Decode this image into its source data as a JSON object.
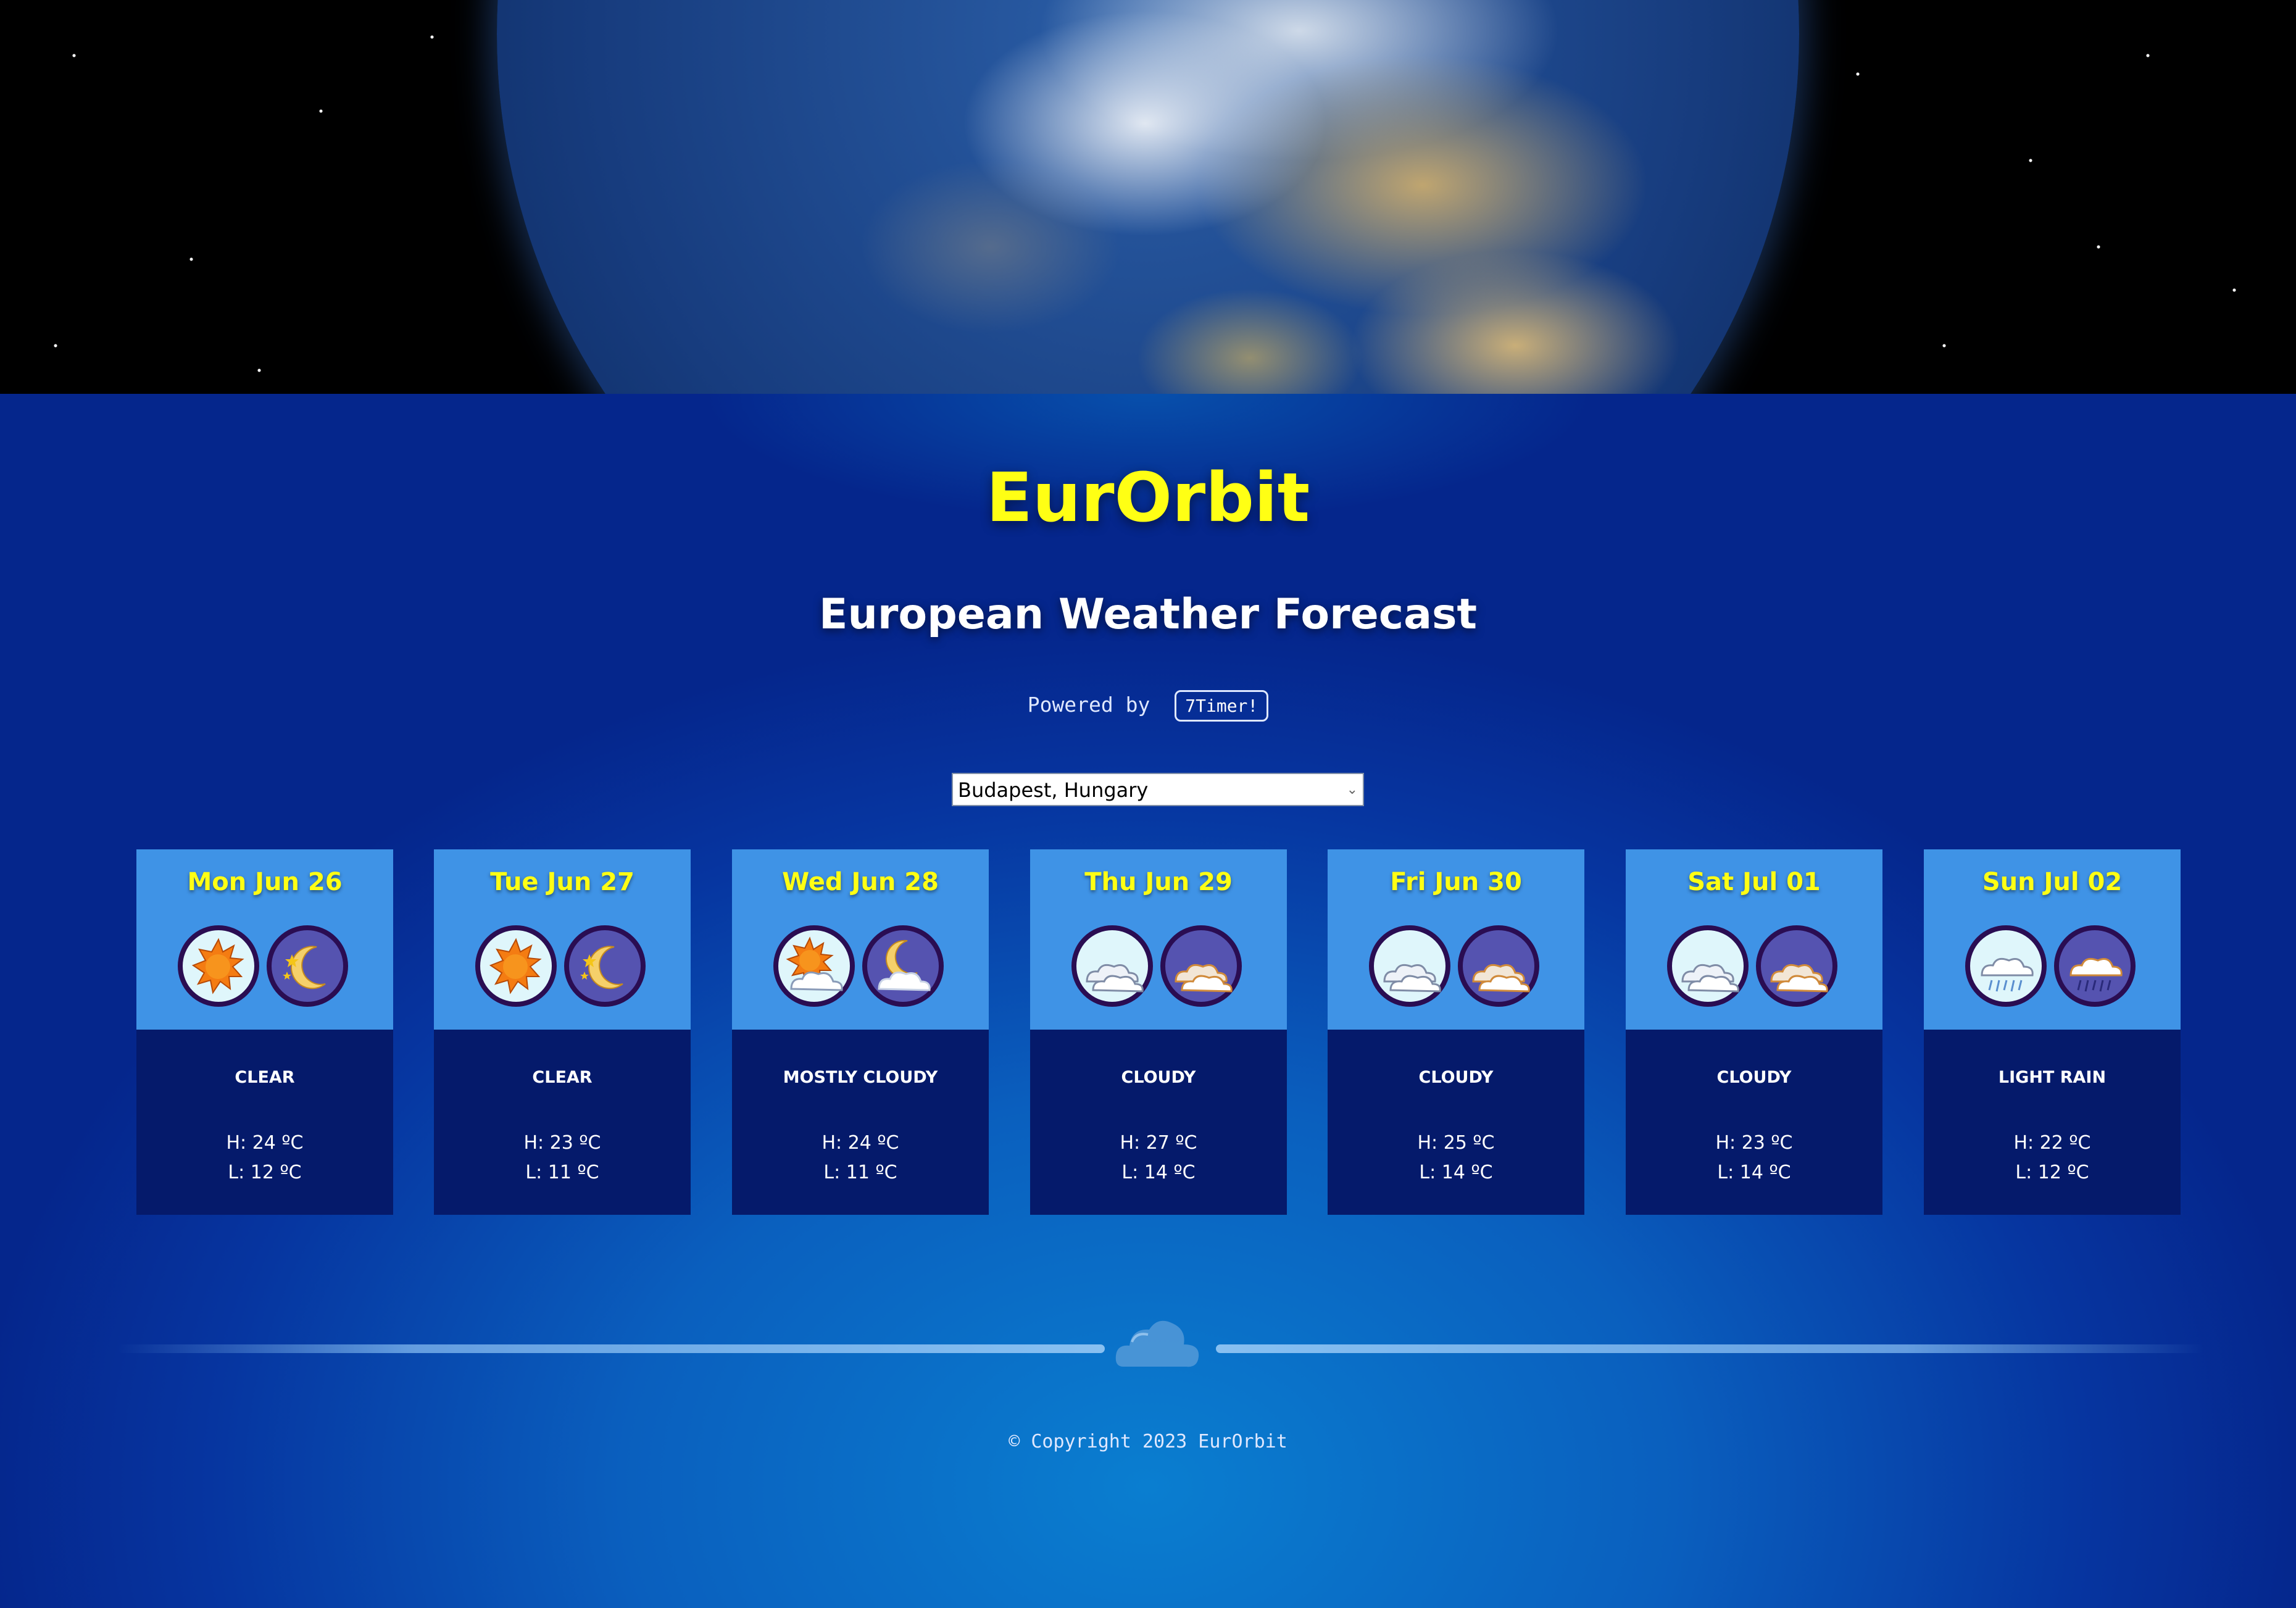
{
  "header": {
    "title": "EurOrbit",
    "subtitle": "European Weather Forecast",
    "powered_by_label": "Powered by",
    "powered_by_link": "7Timer!"
  },
  "location_select": {
    "selected": "Budapest, Hungary"
  },
  "forecast": [
    {
      "date": "Mon Jun 26",
      "condition": "CLEAR",
      "high": "H: 24 ºC",
      "low": "L: 12 ºC",
      "day_icon": "sun-icon",
      "night_icon": "moon-stars-icon"
    },
    {
      "date": "Tue Jun 27",
      "condition": "CLEAR",
      "high": "H: 23 ºC",
      "low": "L: 11 ºC",
      "day_icon": "sun-icon",
      "night_icon": "moon-stars-icon"
    },
    {
      "date": "Wed Jun 28",
      "condition": "MOSTLY CLOUDY",
      "high": "H: 24 ºC",
      "low": "L: 11 ºC",
      "day_icon": "sun-cloud-icon",
      "night_icon": "moon-cloud-icon"
    },
    {
      "date": "Thu Jun 29",
      "condition": "CLOUDY",
      "high": "H: 27 ºC",
      "low": "L: 14 ºC",
      "day_icon": "clouds-day-icon",
      "night_icon": "clouds-night-icon"
    },
    {
      "date": "Fri Jun 30",
      "condition": "CLOUDY",
      "high": "H: 25 ºC",
      "low": "L: 14 ºC",
      "day_icon": "clouds-day-icon",
      "night_icon": "clouds-night-icon"
    },
    {
      "date": "Sat Jul 01",
      "condition": "CLOUDY",
      "high": "H: 23 ºC",
      "low": "L: 14 ºC",
      "day_icon": "clouds-day-icon",
      "night_icon": "clouds-night-icon"
    },
    {
      "date": "Sun Jul 02",
      "condition": "LIGHT RAIN",
      "high": "H: 22 ºC",
      "low": "L: 12 ºC",
      "day_icon": "rain-day-icon",
      "night_icon": "rain-night-icon"
    }
  ],
  "footer": {
    "copyright": "© Copyright 2023 EurOrbit"
  },
  "colors": {
    "title": "#ffff14",
    "card_top": "#3f93e6",
    "card_bottom": "#051a6b",
    "icon_day_bg": "#dff6fb",
    "icon_night_bg": "#5553b0",
    "icon_ring": "#2a0d52"
  }
}
